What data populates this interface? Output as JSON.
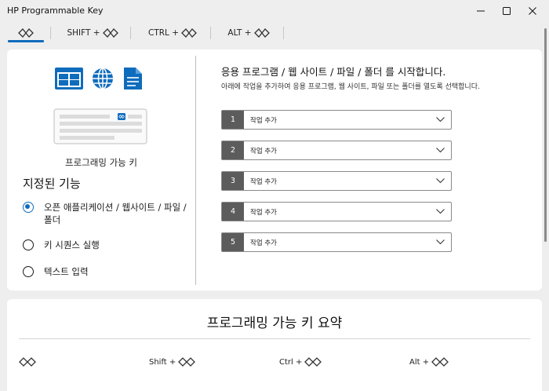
{
  "window": {
    "title": "HP Programmable Key",
    "min_icon": "minimize-icon",
    "max_icon": "maximize-icon",
    "close_icon": "close-icon"
  },
  "tabs": [
    {
      "label": "",
      "icon": "macro-key-icon",
      "active": true
    },
    {
      "label": "SHIFT +",
      "icon": "macro-key-icon",
      "active": false
    },
    {
      "label": "CTRL +",
      "icon": "macro-key-icon",
      "active": false
    },
    {
      "label": "ALT +",
      "icon": "macro-key-icon",
      "active": false
    }
  ],
  "left": {
    "icons": [
      "app-window-icon",
      "globe-icon",
      "file-icon"
    ],
    "keyboard_icon": "keyboard-illustration",
    "prog_label": "프로그래밍 가능 키",
    "func_title": "지정된 기능",
    "options": [
      {
        "label": "오픈 애플리케이션 / 웹사이트 / 파일 / 폴더",
        "selected": true
      },
      {
        "label": "키 시퀀스 실행",
        "selected": false
      },
      {
        "label": "텍스트 입력",
        "selected": false
      }
    ]
  },
  "right": {
    "title": "응용 프로그램 / 웹 사이트 / 파일 / 폴더 를 시작합니다.",
    "desc": "아래에 작업을 추가하여 응용 프로그램, 웹 사이트, 파일 또는 폴더를 열도록 선택합니다.",
    "rows": [
      {
        "num": "1",
        "value": "작업 추가"
      },
      {
        "num": "2",
        "value": "작업 추가"
      },
      {
        "num": "3",
        "value": "작업 추가"
      },
      {
        "num": "4",
        "value": "작업 추가"
      },
      {
        "num": "5",
        "value": "작업 추가"
      }
    ]
  },
  "summary": {
    "title": "프로그래밍 가능 키 요약",
    "items": [
      {
        "label": ""
      },
      {
        "label": "Shift +"
      },
      {
        "label": "Ctrl +"
      },
      {
        "label": "Alt +"
      }
    ]
  },
  "colors": {
    "accent": "#0f6cbd",
    "background": "#eeeeee",
    "card": "#ffffff",
    "row_number_bg": "#5c5c5c"
  }
}
